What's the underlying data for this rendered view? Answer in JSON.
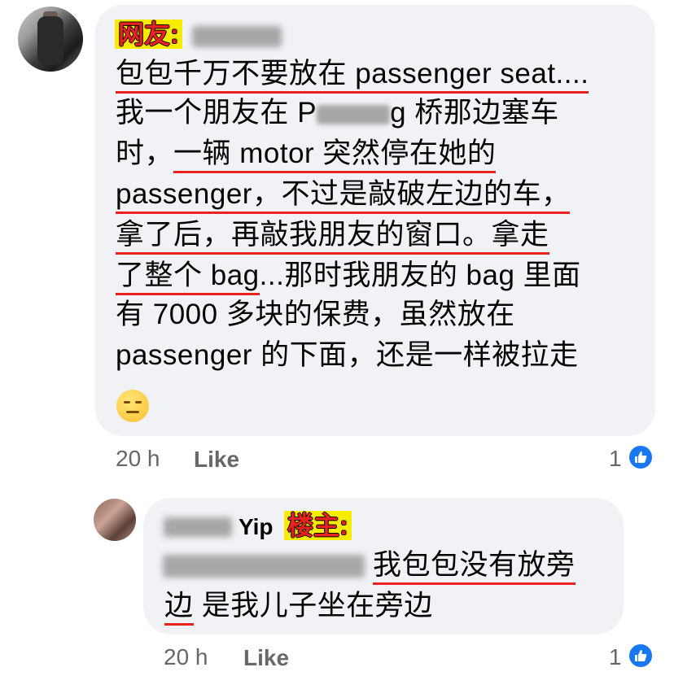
{
  "comment1": {
    "tag": "网友:",
    "lines": [
      "包包千万不要放在 passenger seat....",
      "我一个朋友在 P",
      "g 桥那边塞车",
      "时，",
      "一辆 motor 突然停在她的",
      "passenger，",
      "不过是敲破左边的车，",
      "拿了后，",
      "再敲我朋友的窗口。",
      "拿走",
      "了整个",
      " bag",
      "...那时我朋友的 bag 里面",
      "有 7000 多块的保费，虽然放在",
      "passenger 的下面，还是一样被拉走"
    ],
    "emoji": "expressionless-face",
    "time": "20 h",
    "like_label": "Like",
    "like_count": "1"
  },
  "comment2": {
    "name_suffix": "Yip",
    "tag": "楼主:",
    "line1": "我包包没有放旁",
    "line2_a": "边",
    "line2_b": " 是我儿子坐在旁边",
    "time": "20 h",
    "like_label": "Like",
    "like_count": "1"
  },
  "colors": {
    "bubble": "#f0f2f5",
    "underline": "#e8231f",
    "like_blue": "#1877f2",
    "tag_bg": "#f7ec00",
    "tag_text": "#e8231f"
  }
}
